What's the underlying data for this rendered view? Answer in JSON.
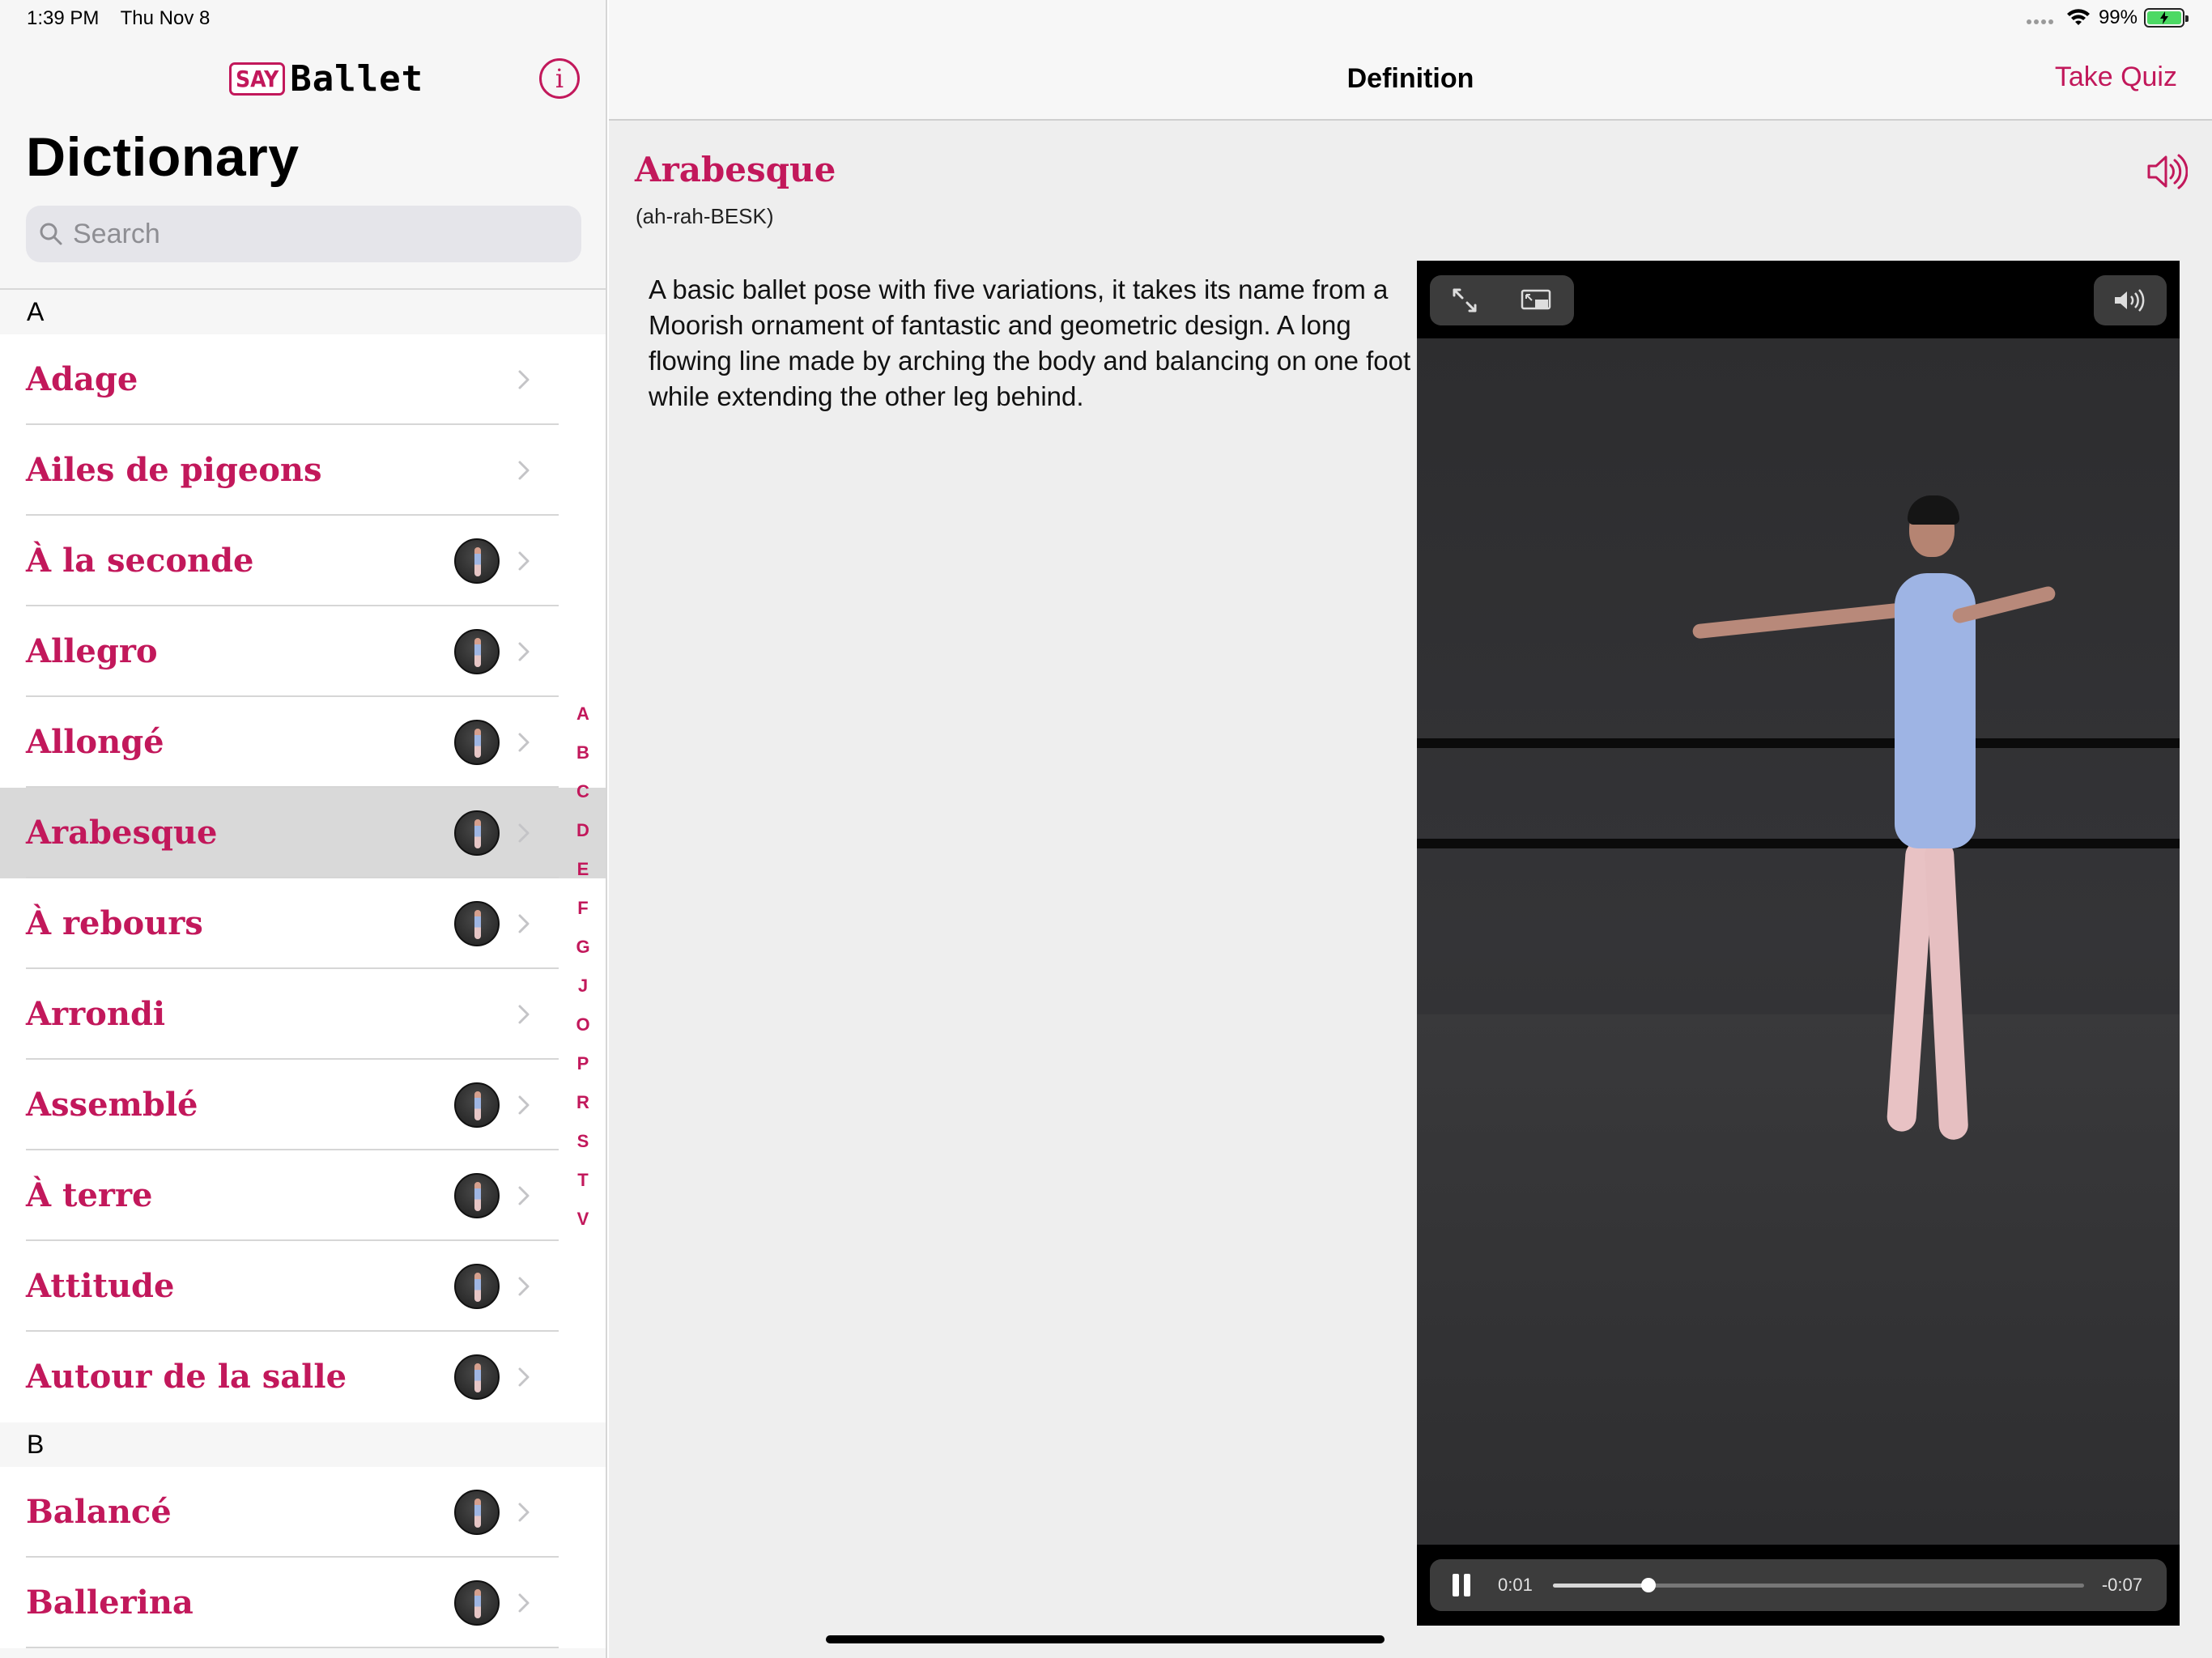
{
  "status_bar": {
    "time": "1:39 PM",
    "date": "Thu Nov 8",
    "battery": "99%"
  },
  "sidebar": {
    "logo_say": "SAY",
    "logo_ballet": "Ballet",
    "info_label": "i",
    "title": "Dictionary",
    "search_placeholder": "Search",
    "sections": [
      {
        "letter": "A",
        "items": [
          {
            "label": "Adage",
            "video": false
          },
          {
            "label": "Ailes de pigeons",
            "video": false
          },
          {
            "label": "À la seconde",
            "video": true
          },
          {
            "label": "Allegro",
            "video": true
          },
          {
            "label": "Allongé",
            "video": true
          },
          {
            "label": "Arabesque",
            "video": true,
            "selected": true
          },
          {
            "label": "À rebours",
            "video": true
          },
          {
            "label": "Arrondi",
            "video": false
          },
          {
            "label": "Assemblé",
            "video": true
          },
          {
            "label": "À terre",
            "video": true
          },
          {
            "label": "Attitude",
            "video": true
          },
          {
            "label": "Autour de la salle",
            "video": true
          }
        ]
      },
      {
        "letter": "B",
        "items": [
          {
            "label": "Balancé",
            "video": true
          },
          {
            "label": "Ballerina",
            "video": true
          }
        ]
      }
    ],
    "index_letters": [
      "A",
      "B",
      "C",
      "D",
      "E",
      "F",
      "G",
      "J",
      "O",
      "P",
      "R",
      "S",
      "T",
      "V"
    ]
  },
  "navbar": {
    "title": "Definition",
    "take_quiz": "Take Quiz"
  },
  "definition": {
    "term": "Arabesque",
    "pronunciation": "(ah-rah-BESK)",
    "text": "A basic ballet pose with five variations, it takes its name from a Moorish ornament of fantastic and geometric design. A long flowing line made by arching the body and balancing on one foot while extending the other leg behind."
  },
  "video_player": {
    "elapsed": "0:01",
    "remaining": "-0:07",
    "progress_fraction": 0.18,
    "state": "playing"
  },
  "colors": {
    "accent": "#c2185b",
    "sidebar_bg": "#f6f6f6",
    "selected_row": "#d9d9d9",
    "battery_green": "#4cd964"
  }
}
